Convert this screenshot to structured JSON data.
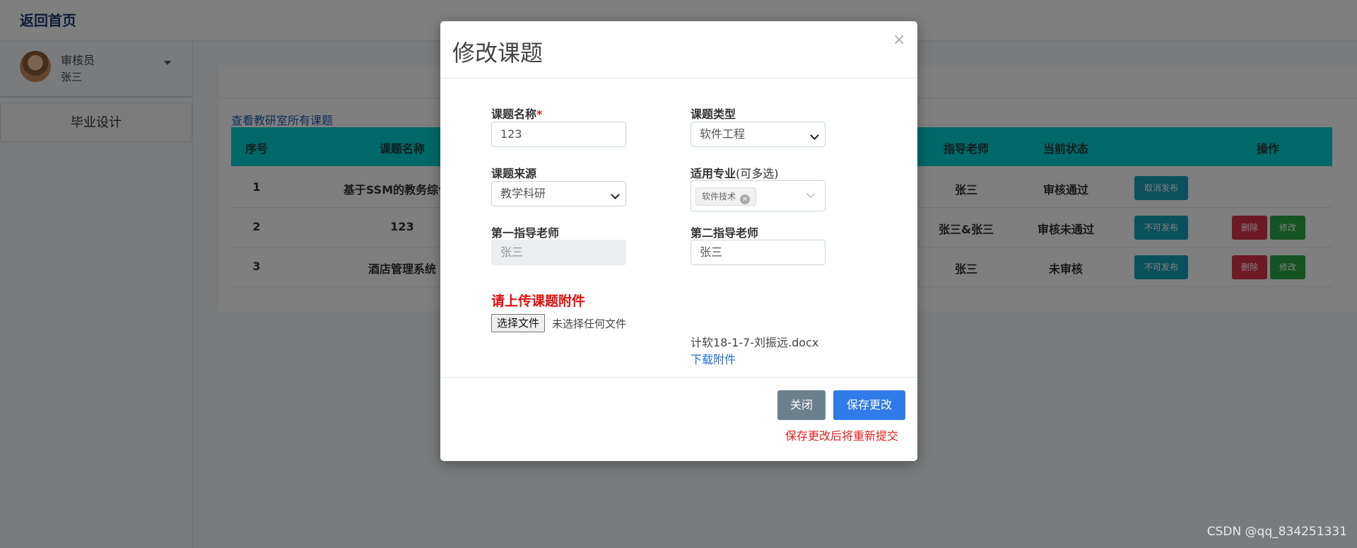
{
  "header": {
    "home_link": "返回首页"
  },
  "user": {
    "role": "审核员",
    "name": "张三"
  },
  "sidebar": {
    "menu_item": "毕业设计"
  },
  "main": {
    "view_all_link": "查看教研室所有课题",
    "table": {
      "headers": [
        "序号",
        "课题名称",
        "指导老师",
        "当前状态",
        "操作"
      ],
      "rows": [
        {
          "no": "1",
          "title": "基于SSM的教务综合管",
          "advisor": "张三",
          "status": "审核通过",
          "buttons": [
            "取消发布"
          ]
        },
        {
          "no": "2",
          "title": "123",
          "advisor": "张三&张三",
          "status": "审核未通过",
          "buttons": [
            "不可发布",
            "删除",
            "修改"
          ]
        },
        {
          "no": "3",
          "title": "酒店管理系统",
          "advisor": "张三",
          "status": "未审核",
          "buttons": [
            "不可发布",
            "删除",
            "修改"
          ]
        }
      ]
    }
  },
  "modal": {
    "title": "修改课题",
    "close_symbol": "×",
    "fields": {
      "topic_name": {
        "label": "课题名称",
        "required_mark": "*",
        "value": "123"
      },
      "topic_type": {
        "label": "课题类型",
        "value": "软件工程"
      },
      "topic_source": {
        "label": "课题来源",
        "value": "教学科研"
      },
      "major": {
        "label": "适用专业",
        "hint": "(可多选)",
        "tags": [
          "软件技术"
        ]
      },
      "first_advisor": {
        "label": "第一指导老师",
        "value": "张三"
      },
      "second_advisor": {
        "label": "第二指导老师",
        "value": "张三"
      }
    },
    "upload": {
      "title": "请上传课题附件",
      "choose_button": "选择文件",
      "no_file": "未选择任何文件",
      "current_file": "计软18-1-7-刘振远.docx",
      "download_link": "下载附件"
    },
    "footer": {
      "close_button": "关闭",
      "save_button": "保存更改",
      "warning": "保存更改后将重新提交"
    }
  },
  "watermark": "CSDN @qq_834251331",
  "colors": {
    "table_header": "#00d0d0",
    "primary": "#2f7be8",
    "danger": "#dc3545",
    "success": "#28a745",
    "info": "#17a2b8",
    "warning_text": "#e02020"
  }
}
